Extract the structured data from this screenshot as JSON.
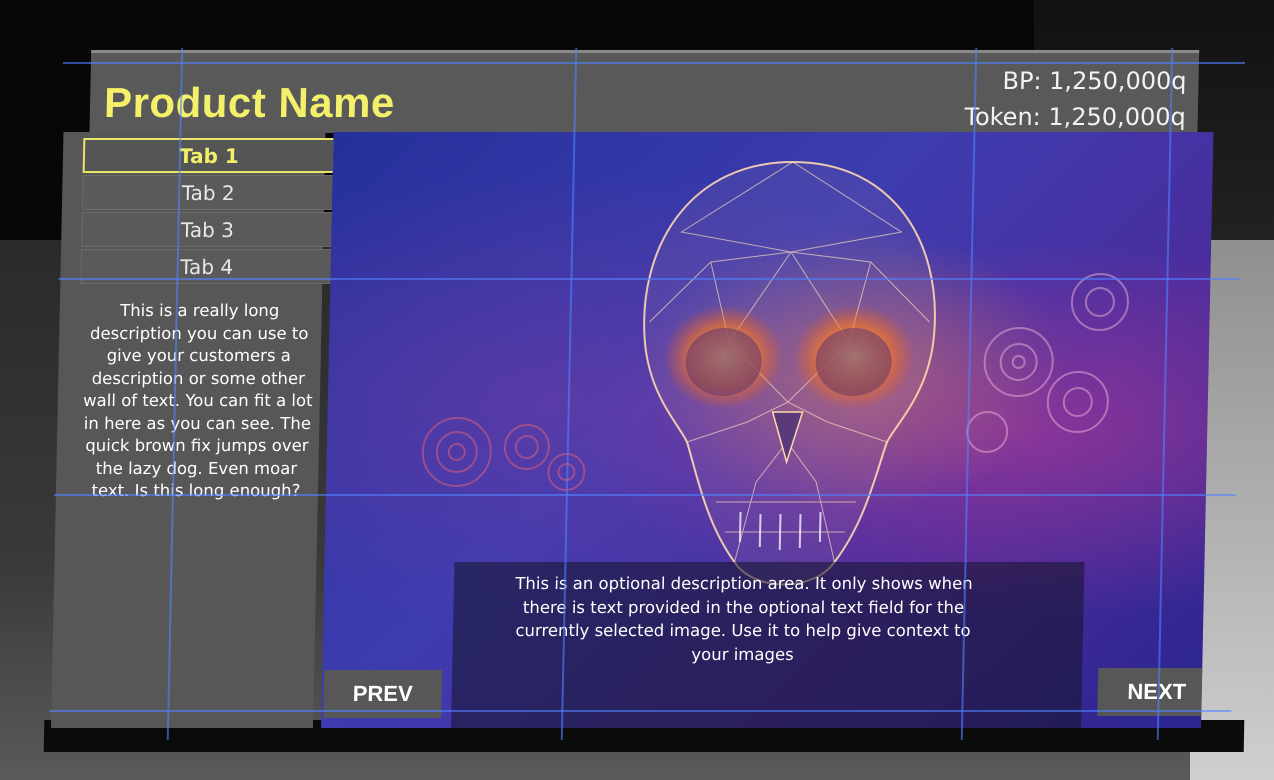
{
  "header": {
    "product_name": "Product Name",
    "bp": "BP: 1,250,000q",
    "token": "Token: 1,250,000q"
  },
  "tabs": [
    {
      "label": "Tab 1",
      "active": true
    },
    {
      "label": "Tab 2",
      "active": false
    },
    {
      "label": "Tab 3",
      "active": false
    },
    {
      "label": "Tab 4",
      "active": false
    }
  ],
  "description": "This is a really long description you can use to give your customers a description or some other wall of text. You can fit a lot in here as you can see. The quick brown fix jumps over the lazy dog. Even moar text. Is this long enough?",
  "image_caption": "This is an optional description area. It only shows when there is text provided in the optional text field for the currently selected image. Use it to help give context to your images",
  "nav": {
    "prev_label": "PREV",
    "next_label": "NEXT"
  },
  "colors": {
    "accent": "#f4f06a",
    "panel": "#575757",
    "grid": "#5a8cff"
  }
}
